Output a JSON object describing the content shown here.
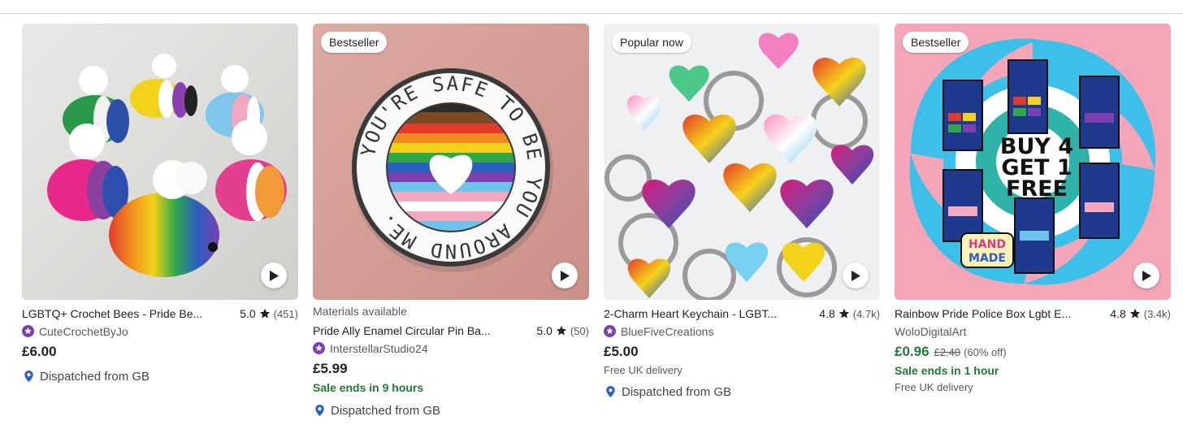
{
  "listings": [
    {
      "badge": "",
      "title": "LGBTQ+ Crochet Bees - Pride Be...",
      "rating": "5.0",
      "reviews": "(451)",
      "materials": "",
      "shop": "CuteCrochetByJo",
      "star_seller": true,
      "price": "£6.00",
      "on_sale": false,
      "original_price": "",
      "discount": "",
      "sale_ends": "",
      "free_delivery": "",
      "dispatch": "Dispatched from GB"
    },
    {
      "badge": "Bestseller",
      "title": "Pride Ally Enamel Circular Pin Ba...",
      "rating": "5.0",
      "reviews": "(50)",
      "materials": "Materials available",
      "shop": "InterstellarStudio24",
      "star_seller": true,
      "price": "£5.99",
      "on_sale": false,
      "original_price": "",
      "discount": "",
      "sale_ends": "Sale ends in 9 hours",
      "free_delivery": "",
      "dispatch": "Dispatched from GB",
      "pin_text": "YOU'RE SAFE TO BE YOU AROUND ME."
    },
    {
      "badge": "Popular now",
      "title": "2-Charm Heart Keychain - LGBT...",
      "rating": "4.8",
      "reviews": "(4.7k)",
      "materials": "",
      "shop": "BlueFiveCreations",
      "star_seller": true,
      "price": "£5.00",
      "on_sale": false,
      "original_price": "",
      "discount": "",
      "sale_ends": "",
      "free_delivery": "Free UK delivery",
      "dispatch": "Dispatched from GB"
    },
    {
      "badge": "Bestseller",
      "title": "Rainbow Pride Police Box Lgbt E...",
      "rating": "4.8",
      "reviews": "(3.4k)",
      "materials": "",
      "shop": "WoloDigitalArt",
      "star_seller": false,
      "price": "£0.96",
      "on_sale": true,
      "original_price": "£2.40",
      "discount": "(60% off)",
      "sale_ends": "Sale ends in 1 hour",
      "free_delivery": "Free UK delivery",
      "dispatch": "",
      "promo_lines": [
        "BUY 4",
        "GET 1",
        "FREE"
      ],
      "handmade_lines": [
        "HAND",
        "MADE"
      ]
    }
  ],
  "colors": {
    "sale_green": "#1f7a33",
    "star_seller_purple": "#7b3fb0",
    "pin_blue": "#2f5ec4"
  },
  "icons": {
    "rating": "star-icon",
    "play": "play-icon",
    "shop": "star-seller-icon",
    "dispatch": "location-pin-icon"
  }
}
